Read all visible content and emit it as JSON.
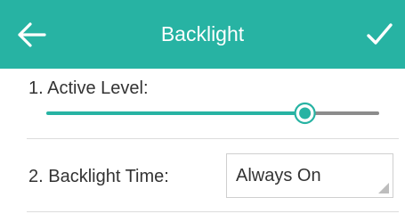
{
  "header": {
    "title": "Backlight",
    "background_color": "#27b3a3",
    "back_icon": "arrow-left-icon",
    "confirm_icon": "checkmark-icon"
  },
  "settings": {
    "active_level": {
      "label": "1. Active Level:",
      "value_fraction": 0.78,
      "accent_color": "#27b3a3",
      "track_color": "#8c8c8c"
    },
    "backlight_time": {
      "label": "2. Backlight Time:",
      "selected_value": "Always On"
    }
  }
}
